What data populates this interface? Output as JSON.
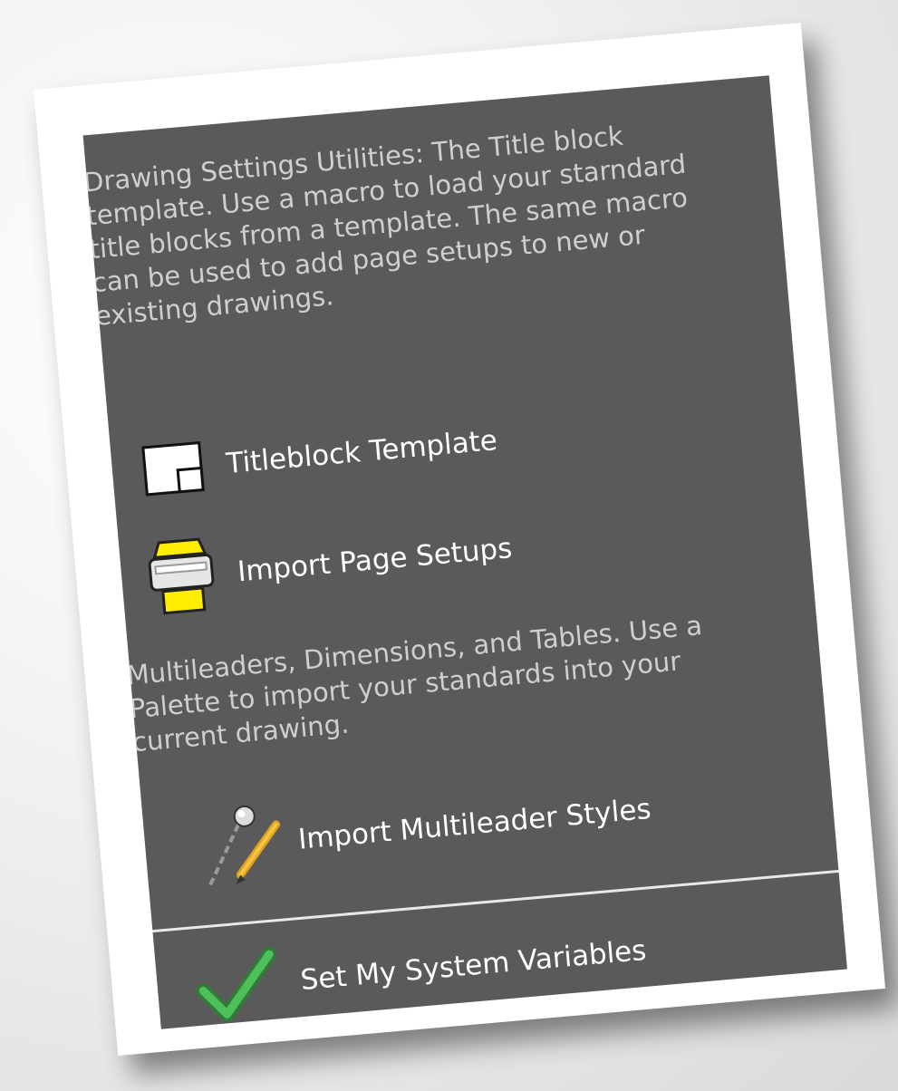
{
  "panel": {
    "description_1": "Drawing Settings Utilities: The Title block template.  Use a macro to load your starndard title blocks from a template.  The same macro can be used to add page setups to new or existing drawings.",
    "items": [
      {
        "label": "Titleblock Template",
        "icon": "titleblock-icon"
      },
      {
        "label": "Import Page Setups",
        "icon": "printer-icon"
      }
    ],
    "description_2": "Multileaders, Dimensions, and Tables. Use a Palette to import your standards into your current drawing.",
    "items_2": [
      {
        "label": "Import Multileader Styles",
        "icon": "multileader-icon"
      }
    ],
    "footer_item": {
      "label": "Set My System Variables",
      "icon": "checkmark-icon"
    }
  },
  "colors": {
    "panel_bg": "#5a5a5a",
    "description_text": "#cfcfcf",
    "label_text": "#ffffff",
    "checkmark": "#3fa24a",
    "printer_yellow": "#ffee00"
  }
}
